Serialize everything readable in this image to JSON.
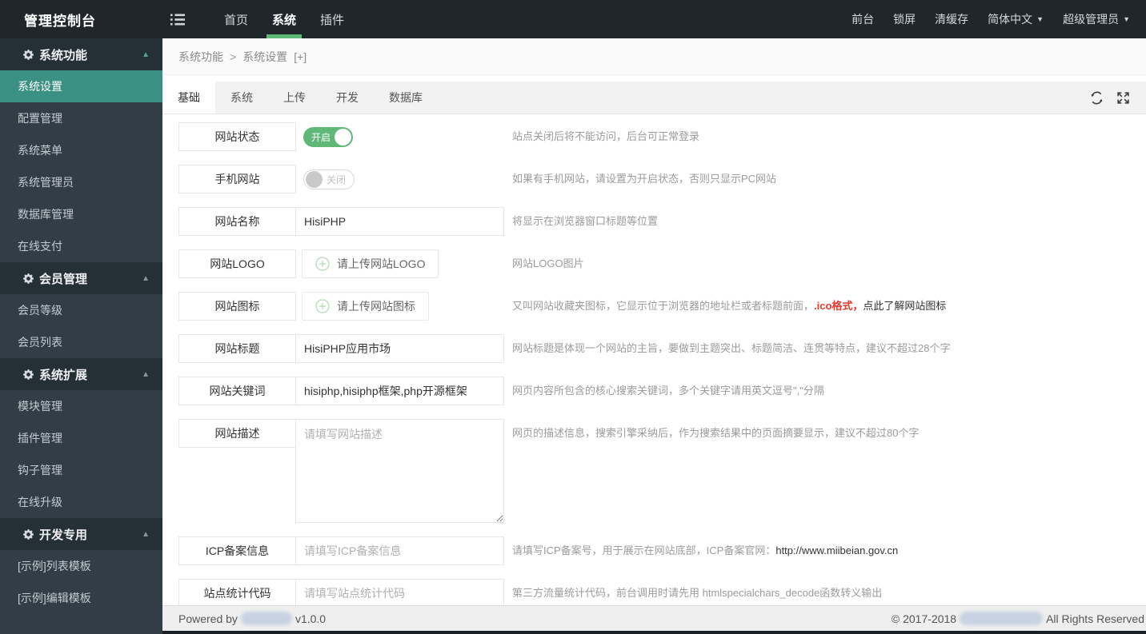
{
  "colors": {
    "accent_green": "#5FB878",
    "active_teal": "#3A9183",
    "red_text": "#E43A2F",
    "navbar_bg": "#21262C",
    "sidebar_bg": "#323D46"
  },
  "icons": {
    "menu": "list-icon",
    "section": "gear-icon",
    "collapse": "caret-up-icon",
    "dropdown": "caret-down-icon",
    "refresh": "refresh-icon",
    "fullscreen": "fullscreen-icon",
    "upload": "plus-circle-icon"
  },
  "navbar": {
    "brand": "管理控制台",
    "items": [
      {
        "label": "首页",
        "active": false
      },
      {
        "label": "系统",
        "active": true
      },
      {
        "label": "插件",
        "active": false
      }
    ],
    "right_items": [
      {
        "label": "前台",
        "caret": false
      },
      {
        "label": "锁屏",
        "caret": false
      },
      {
        "label": "清缓存",
        "caret": false
      },
      {
        "label": "简体中文",
        "caret": true
      },
      {
        "label": "超级管理员",
        "caret": true
      }
    ]
  },
  "sidebar": {
    "sections": [
      {
        "title": "系统功能",
        "expanded": true,
        "arrow_teal": true,
        "items": [
          {
            "label": "系统设置",
            "active": true
          },
          {
            "label": "配置管理",
            "active": false
          },
          {
            "label": "系统菜单",
            "active": false
          },
          {
            "label": "系统管理员",
            "active": false
          },
          {
            "label": "数据库管理",
            "active": false
          },
          {
            "label": "在线支付",
            "active": false
          }
        ]
      },
      {
        "title": "会员管理",
        "expanded": true,
        "arrow_teal": false,
        "items": [
          {
            "label": "会员等级",
            "active": false
          },
          {
            "label": "会员列表",
            "active": false
          }
        ]
      },
      {
        "title": "系统扩展",
        "expanded": true,
        "arrow_teal": false,
        "items": [
          {
            "label": "模块管理",
            "active": false
          },
          {
            "label": "插件管理",
            "active": false
          },
          {
            "label": "钩子管理",
            "active": false
          },
          {
            "label": "在线升级",
            "active": false
          }
        ]
      },
      {
        "title": "开发专用",
        "expanded": true,
        "arrow_teal": false,
        "items": [
          {
            "label": "[示例]列表模板",
            "active": false
          },
          {
            "label": "[示例]编辑模板",
            "active": false
          }
        ]
      }
    ]
  },
  "breadcrumb": {
    "parts": [
      "系统功能",
      "系统设置"
    ],
    "separator": ">",
    "suffix": "[+]"
  },
  "tabs": {
    "active_index": 0,
    "items": [
      "基础",
      "系统",
      "上传",
      "开发",
      "数据库"
    ]
  },
  "form": {
    "rows": [
      {
        "label": "网站状态",
        "control": {
          "type": "toggle",
          "state": "on",
          "text": "开启"
        },
        "help": [
          {
            "text": "站点关闭后将不能访问，后台可正常登录",
            "style": "normal"
          }
        ]
      },
      {
        "label": "手机网站",
        "control": {
          "type": "toggle",
          "state": "off",
          "text": "关闭"
        },
        "help": [
          {
            "text": "如果有手机网站，请设置为开启状态，否则只显示PC网站",
            "style": "normal"
          }
        ]
      },
      {
        "label": "网站名称",
        "control": {
          "type": "input",
          "value": "HisiPHP",
          "placeholder": ""
        },
        "help": [
          {
            "text": "将显示在浏览器窗口标题等位置",
            "style": "normal"
          }
        ]
      },
      {
        "label": "网站LOGO",
        "control": {
          "type": "upload",
          "text": "请上传网站LOGO"
        },
        "help": [
          {
            "text": "网站LOGO图片",
            "style": "normal"
          }
        ]
      },
      {
        "label": "网站图标",
        "control": {
          "type": "upload",
          "text": "请上传网站图标"
        },
        "help": [
          {
            "text": "又叫网站收藏夹图标，它显示位于浏览器的地址栏或者标题前面，",
            "style": "normal"
          },
          {
            "text": ".ico格式，",
            "style": "red"
          },
          {
            "text": "点此了解网站图标",
            "style": "dark"
          }
        ]
      },
      {
        "label": "网站标题",
        "control": {
          "type": "input",
          "value": "HisiPHP应用市场",
          "placeholder": ""
        },
        "help": [
          {
            "text": "网站标题是体现一个网站的主旨，要做到主题突出、标题简洁、连贯等特点，建议不超过28个字",
            "style": "normal"
          }
        ]
      },
      {
        "label": "网站关键词",
        "control": {
          "type": "input",
          "value": "hisiphp,hisiphp框架,php开源框架",
          "placeholder": ""
        },
        "help": [
          {
            "text": "网页内容所包含的核心搜索关键词，多个关键字请用英文逗号\",\"分隔",
            "style": "normal"
          }
        ]
      },
      {
        "label": "网站描述",
        "control": {
          "type": "textarea",
          "value": "",
          "placeholder": "请填写网站描述"
        },
        "help": [
          {
            "text": "网页的描述信息，搜索引擎采纳后，作为搜索结果中的页面摘要显示，建议不超过80个字",
            "style": "normal"
          }
        ]
      },
      {
        "label": "ICP备案信息",
        "control": {
          "type": "input",
          "value": "",
          "placeholder": "请填写ICP备案信息"
        },
        "help": [
          {
            "text": "请填写ICP备案号，用于展示在网站底部，ICP备案官网：",
            "style": "normal"
          },
          {
            "text": "http://www.miibeian.gov.cn",
            "style": "dark"
          }
        ]
      },
      {
        "label": "站点统计代码",
        "control": {
          "type": "input",
          "value": "",
          "placeholder": "请填写站点统计代码"
        },
        "help": [
          {
            "text": "第三方流量统计代码，前台调用时请先用 htmlspecialchars_decode函数转义输出",
            "style": "normal"
          }
        ]
      }
    ]
  },
  "footer": {
    "left_prefix": "Powered by",
    "left_suffix": "v1.0.0",
    "right_prefix": "© 2017-2018",
    "right_suffix": "All Rights Reserved"
  }
}
